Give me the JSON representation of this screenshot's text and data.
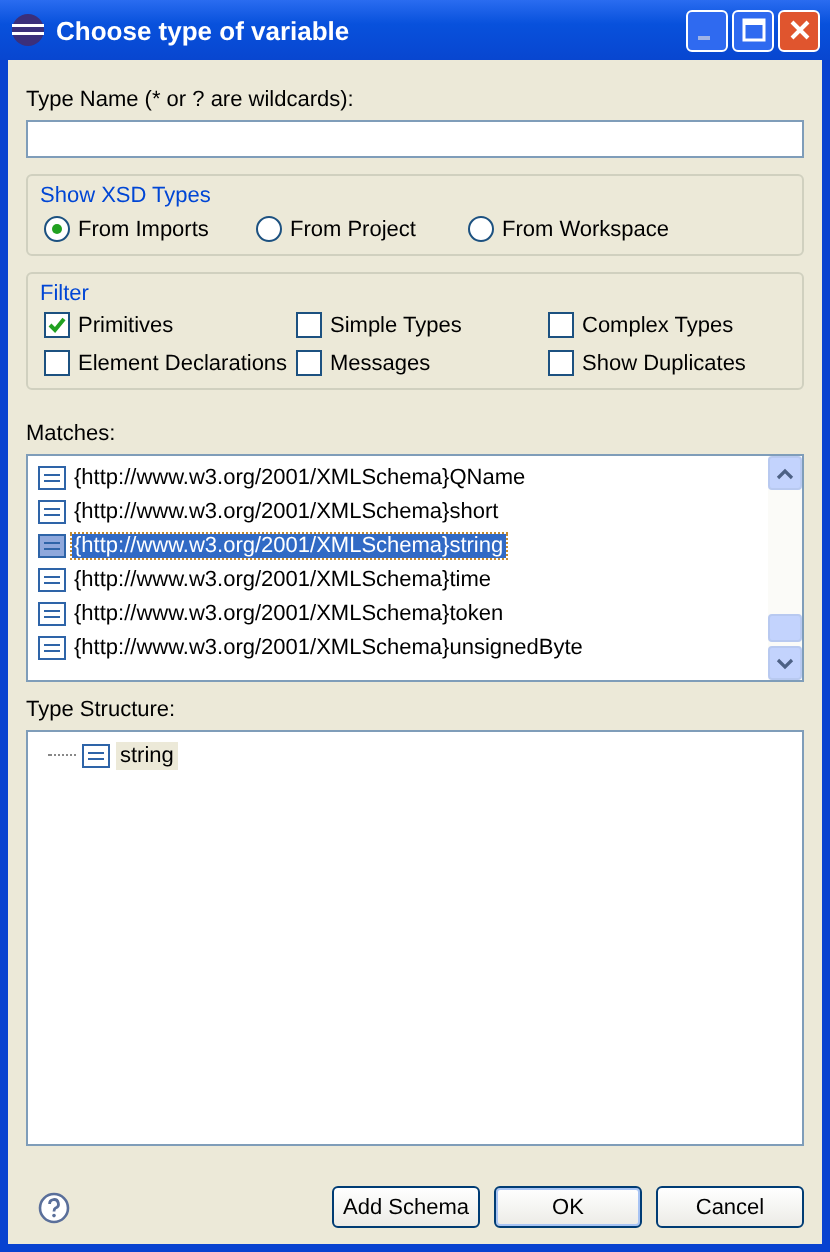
{
  "window": {
    "title": "Choose type of variable"
  },
  "type_name": {
    "label": "Type Name (* or ? are wildcards):"
  },
  "show_xsd_types": {
    "title": "Show XSD Types",
    "options": [
      {
        "label": "From Imports",
        "selected": true
      },
      {
        "label": "From Project",
        "selected": false
      },
      {
        "label": "From Workspace",
        "selected": false
      }
    ]
  },
  "filter": {
    "title": "Filter",
    "options": [
      {
        "label": "Primitives",
        "checked": true
      },
      {
        "label": "Simple Types",
        "checked": false
      },
      {
        "label": "Complex Types",
        "checked": false
      },
      {
        "label": "Element Declarations",
        "checked": false
      },
      {
        "label": "Messages",
        "checked": false
      },
      {
        "label": "Show Duplicates",
        "checked": false
      }
    ]
  },
  "matches": {
    "label": "Matches:",
    "items": [
      {
        "text": "{http://www.w3.org/2001/XMLSchema}QName",
        "selected": false
      },
      {
        "text": "{http://www.w3.org/2001/XMLSchema}short",
        "selected": false
      },
      {
        "text": "{http://www.w3.org/2001/XMLSchema}string",
        "selected": true
      },
      {
        "text": "{http://www.w3.org/2001/XMLSchema}time",
        "selected": false
      },
      {
        "text": "{http://www.w3.org/2001/XMLSchema}token",
        "selected": false
      },
      {
        "text": "{http://www.w3.org/2001/XMLSchema}unsignedByte",
        "selected": false
      }
    ]
  },
  "type_structure": {
    "label": "Type Structure:",
    "nodes": [
      {
        "text": "string",
        "selected": true
      }
    ]
  },
  "buttons": [
    {
      "label": "Add Schema",
      "default": false
    },
    {
      "label": "OK",
      "default": true
    },
    {
      "label": "Cancel",
      "default": false
    }
  ]
}
